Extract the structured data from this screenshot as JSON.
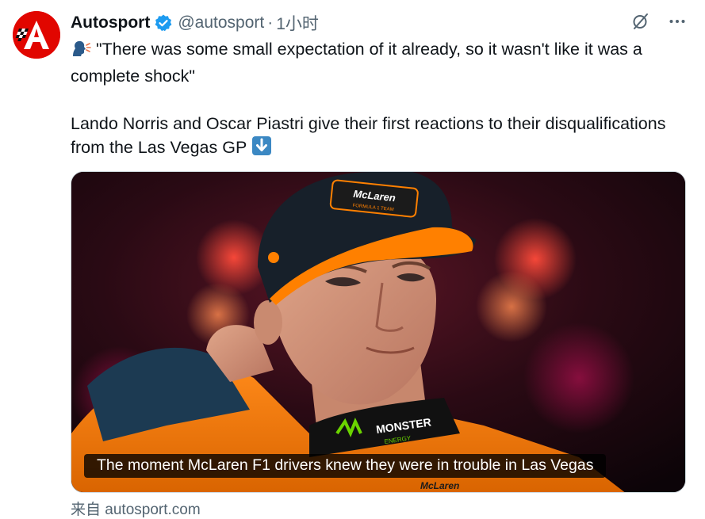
{
  "author": {
    "name": "Autosport",
    "handle": "@autosport",
    "separator": "·",
    "time": "1小时",
    "avatar_icon": "autosport-logo",
    "verified_icon": "verified-badge-icon",
    "brand_color": "#e10600"
  },
  "actions": {
    "grok_icon": "grok-icon",
    "more_icon": "more-icon"
  },
  "tweet": {
    "line1_emoji": "speaking-head-emoji",
    "line1": "\"There was some small expectation of it already, so it wasn't like it was a complete shock\"",
    "line2": "Lando Norris and Oscar Piastri give their first reactions to their disqualifications from the Las Vegas GP",
    "line2_emoji": "down-arrow-emoji"
  },
  "media": {
    "caption": "The moment McLaren F1 drivers knew they were in trouble in Las Vegas",
    "cap_logo": "McLaren",
    "cap_sub": "FORMULA 1 TEAM",
    "collar_brand": "MONSTER",
    "collar_sub": "ENERGY",
    "suit_brand": "McLaren"
  },
  "card_source": "来自 autosport.com",
  "colors": {
    "text": "#0f1419",
    "secondary": "#536471",
    "verified": "#1d9bf0",
    "papaya": "#ff8000"
  }
}
